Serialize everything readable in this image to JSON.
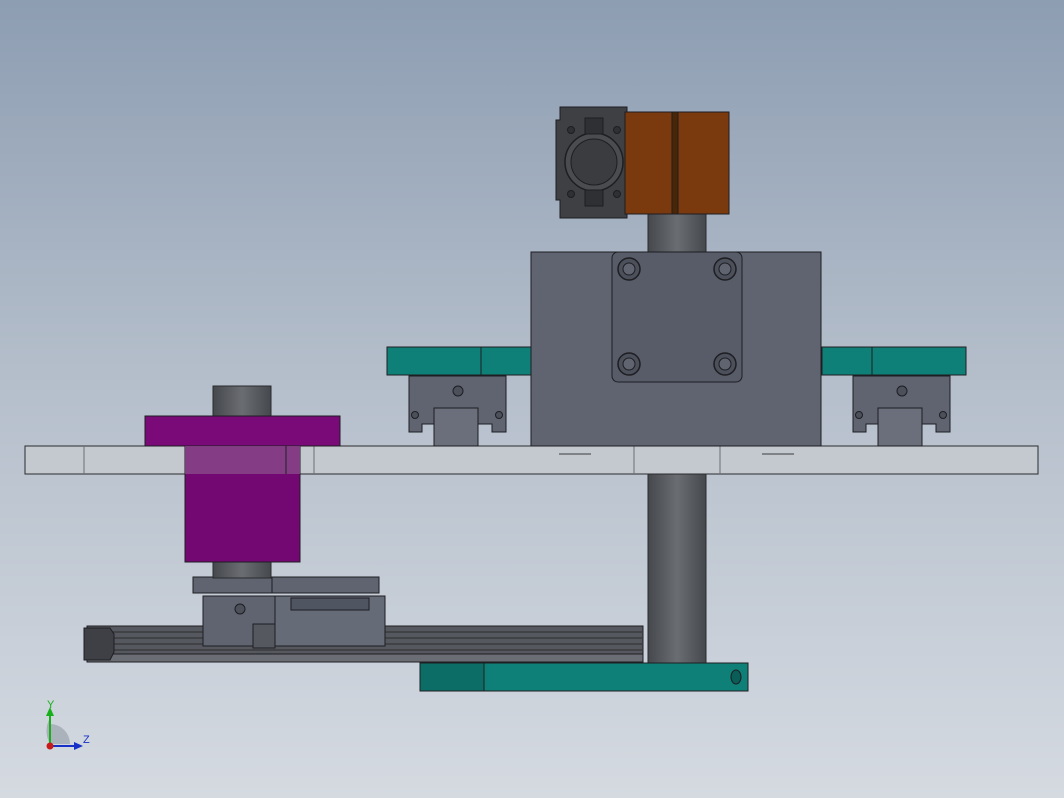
{
  "viewport": {
    "background_top": "#8d9db2",
    "background_bottom": "#d5dae1"
  },
  "model": {
    "plate_color": "#c4c8cf",
    "body_color": "#5f6470",
    "shaft_color": "#55585d",
    "rail_color": "#0e8077",
    "collar_color": "#7a0a78",
    "coupling_color": "#7a3a0d",
    "edge_color": "#1e1e22"
  },
  "triad": {
    "y_label": "Y",
    "z_label": "Z",
    "y_color": "#17b01a",
    "z_color": "#1730c8",
    "origin_color": "#c81a1a"
  }
}
